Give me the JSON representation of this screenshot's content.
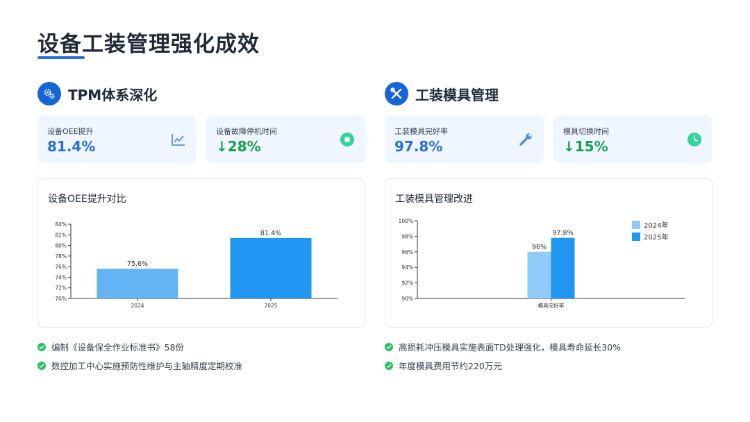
{
  "page": {
    "title": "设备工装管理强化成效"
  },
  "colors": {
    "accent": "#2b6fd8",
    "green": "#16a34a",
    "bar_light": "#64b5f6",
    "bar_dark": "#2196f3",
    "bar_light2": "#90caf9"
  },
  "left": {
    "section_title": "TPM体系深化",
    "section_icon": "gears-icon",
    "kpis": [
      {
        "label": "设备OEE提升",
        "value": "81.4%",
        "icon": "line-chart-icon"
      },
      {
        "label": "设备故障停机时间",
        "value": "↓28%",
        "icon": "stop-circle-icon"
      }
    ],
    "chart_title": "设备OEE提升对比",
    "bullets": [
      "编制《设备保全作业标准书》58份",
      "数控加工中心实施预防性维护与主轴精度定期校准"
    ]
  },
  "right": {
    "section_title": "工装模具管理",
    "section_icon": "tools-icon",
    "kpis": [
      {
        "label": "工装模具完好率",
        "value": "97.8%",
        "icon": "wrench-icon"
      },
      {
        "label": "模具切换时间",
        "value": "↓15%",
        "icon": "clock-icon"
      }
    ],
    "chart_title": "工装模具管理改进",
    "bullets": [
      "高损耗冲压模具实施表面TD处理强化，模具寿命延长30%",
      "年度模具费用节约220万元"
    ]
  },
  "chart_data": [
    {
      "type": "bar",
      "title": "设备OEE提升对比",
      "categories": [
        "2024",
        "2025"
      ],
      "values": [
        75.6,
        81.4
      ],
      "data_labels": [
        "75.6%",
        "81.4%"
      ],
      "ylim": [
        70,
        84
      ],
      "yticks": [
        "70%",
        "72%",
        "74%",
        "76%",
        "78%",
        "80%",
        "82%",
        "84%"
      ],
      "grid": false
    },
    {
      "type": "bar",
      "title": "工装模具管理改进",
      "categories": [
        "模具完好率"
      ],
      "series": [
        {
          "name": "2024年",
          "values": [
            96
          ],
          "data_labels": [
            "96%"
          ]
        },
        {
          "name": "2025年",
          "values": [
            97.8
          ],
          "data_labels": [
            "97.8%"
          ]
        }
      ],
      "ylim": [
        90,
        100
      ],
      "yticks": [
        "90%",
        "92%",
        "94%",
        "96%",
        "98%",
        "100%"
      ],
      "legend": "top-right",
      "grid": false
    }
  ]
}
